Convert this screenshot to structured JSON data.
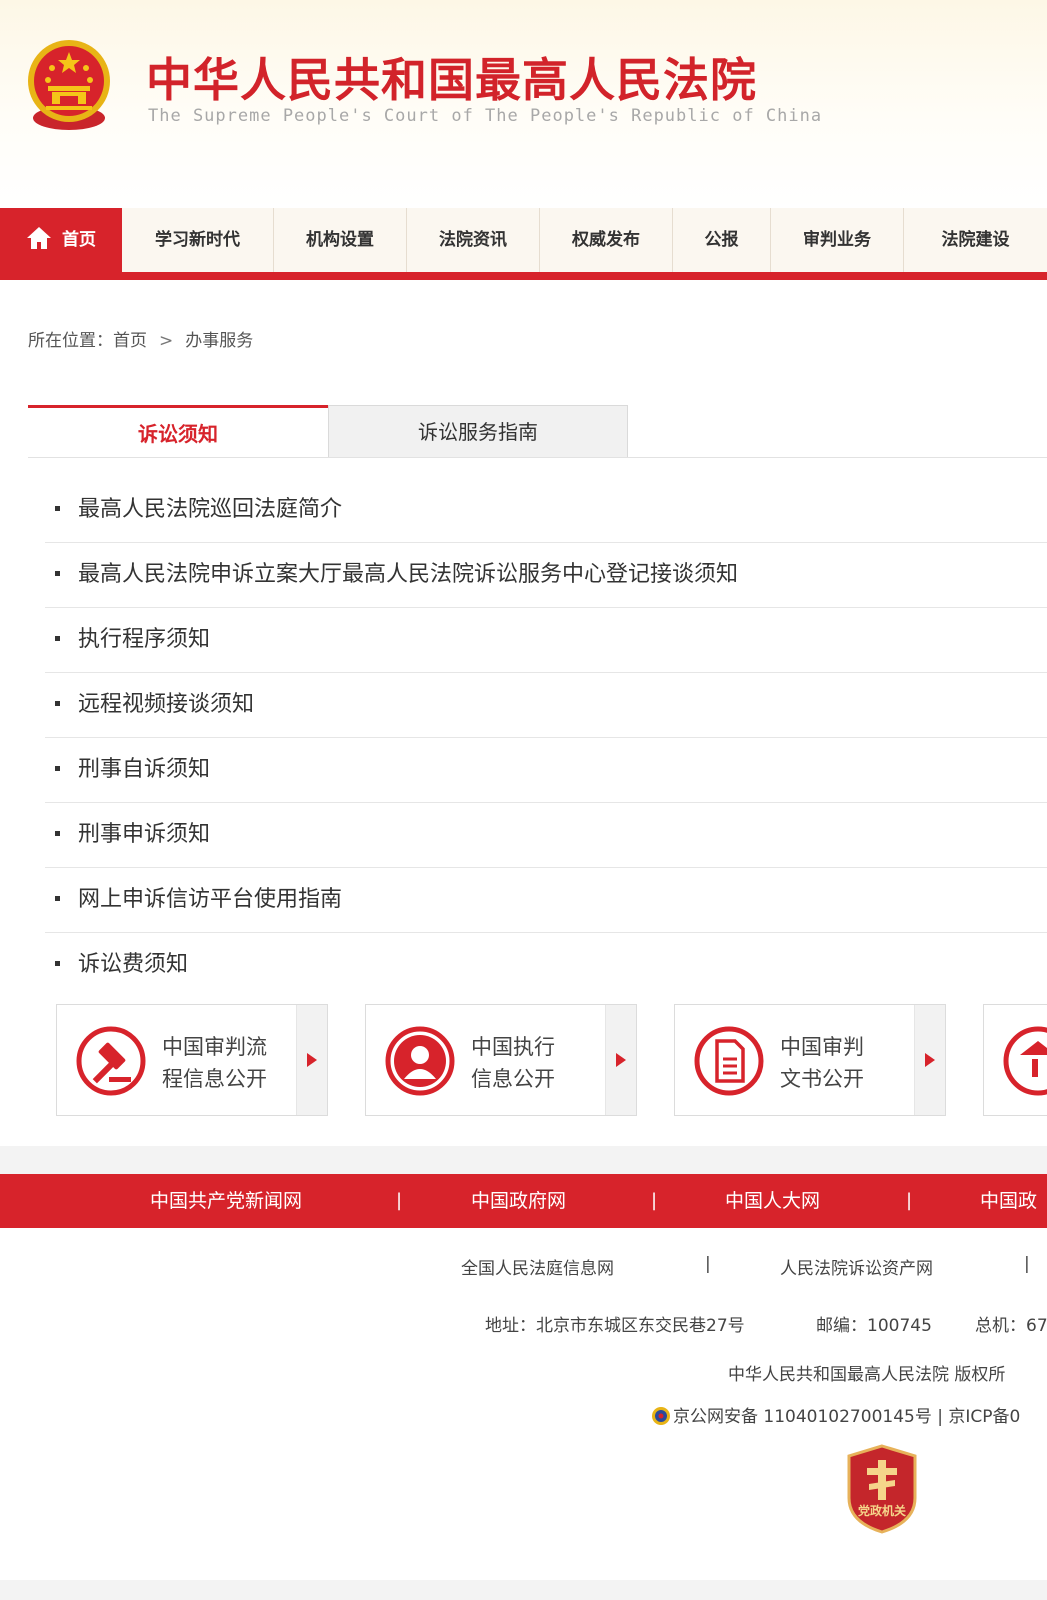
{
  "header": {
    "title": "中华人民共和国最高人民法院",
    "subtitle": "The Supreme People's Court of The People's Republic of China"
  },
  "nav": {
    "items": [
      {
        "label": "首页",
        "active": true,
        "icon": "home-icon"
      },
      {
        "label": "学习新时代"
      },
      {
        "label": "机构设置"
      },
      {
        "label": "法院资讯"
      },
      {
        "label": "权威发布"
      },
      {
        "label": "公报"
      },
      {
        "label": "审判业务"
      },
      {
        "label": "法院建设"
      }
    ]
  },
  "breadcrumb": {
    "prefix": "所在位置：",
    "home": "首页",
    "separator": ">",
    "current": "办事服务"
  },
  "tabs": [
    {
      "label": "诉讼须知",
      "active": true
    },
    {
      "label": "诉讼服务指南",
      "active": false
    }
  ],
  "list": [
    "最高人民法院巡回法庭简介",
    "最高人民法院申诉立案大厅最高人民法院诉讼服务中心登记接谈须知",
    "执行程序须知",
    "远程视频接谈须知",
    "刑事自诉须知",
    "刑事申诉须知",
    "网上申诉信访平台使用指南",
    "诉讼费须知"
  ],
  "cards": [
    {
      "line1": "中国审判流",
      "line2": "程信息公开",
      "icon": "gavel-icon"
    },
    {
      "line1": "中国执行",
      "line2": "信息公开",
      "icon": "person-icon"
    },
    {
      "line1": "中国审判",
      "line2": "文书公开",
      "icon": "document-icon"
    },
    {
      "icon": "building-icon"
    }
  ],
  "footer": {
    "links": [
      "中国共产党新闻网",
      "中国政府网",
      "中国人大网",
      "中国政"
    ],
    "link_separator": "|",
    "links2": [
      "全国人民法庭信息网",
      "人民法院诉讼资产网"
    ],
    "address": "地址：北京市东城区东交民巷27号",
    "postcode": "邮编：100745",
    "phone": "总机：67",
    "copyright": "中华人民共和国最高人民法院 版权所",
    "icp": "京公网安备 11040102700145号 | 京ICP备0",
    "badge_text": "党政机关"
  },
  "colors": {
    "brand_red": "#d7232b",
    "emblem_gold": "#f5c518"
  }
}
